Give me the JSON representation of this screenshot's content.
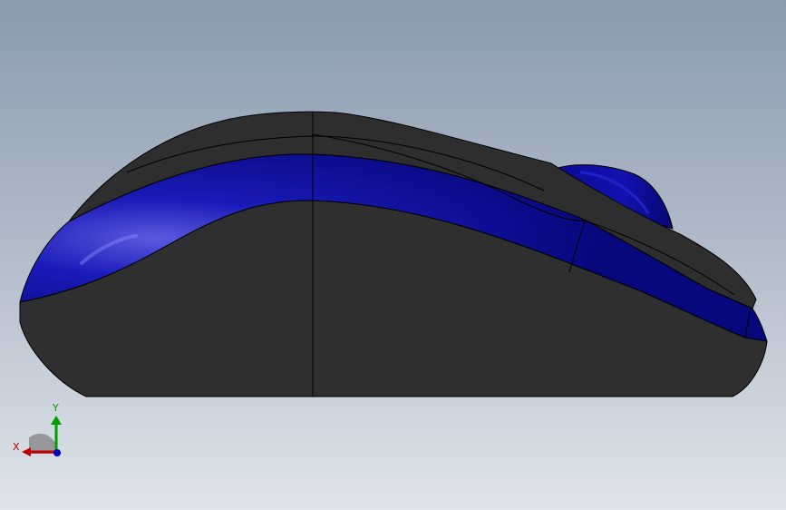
{
  "viewport": {
    "background_top": "#8a9bb0",
    "background_bottom": "#dfe4ea"
  },
  "model": {
    "name": "wireless-mouse-side-view",
    "body_color": "#2e2e2e",
    "accent_color": "#0a0a9a",
    "edge_color": "#000000"
  },
  "triad": {
    "x_label": "X",
    "y_label": "Y",
    "x_color": "#c00000",
    "y_color": "#00a000",
    "z_color": "#0000c0"
  }
}
